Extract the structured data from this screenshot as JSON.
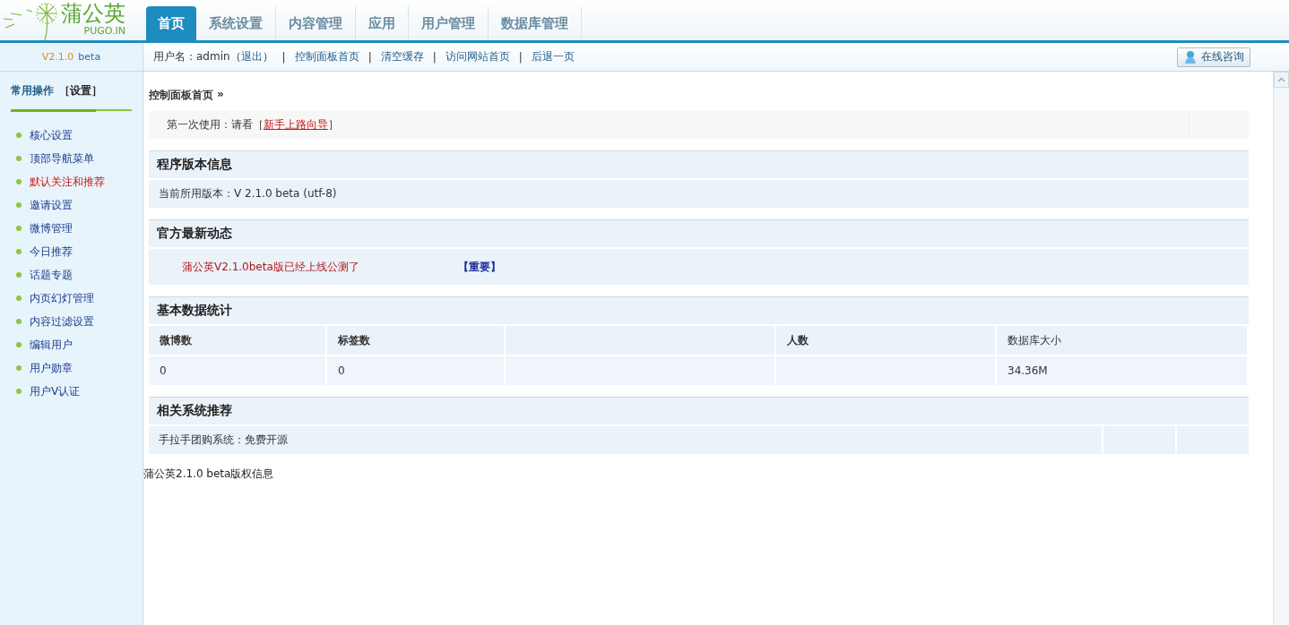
{
  "logo": {
    "title": "蒲公英",
    "subtitle": "PUGO.IN"
  },
  "tabs": [
    {
      "label": "首页",
      "selected": true
    },
    {
      "label": "系统设置",
      "selected": false
    },
    {
      "label": "内容管理",
      "selected": false
    },
    {
      "label": "应用",
      "selected": false
    },
    {
      "label": "用户管理",
      "selected": false
    },
    {
      "label": "数据库管理",
      "selected": false
    }
  ],
  "version": {
    "number": "V2.1.0",
    "edition": "beta"
  },
  "user_bar": {
    "user_text": "用户名：admin（",
    "logout": "退出",
    "user_text_end": "）",
    "links": [
      {
        "separator": "|",
        "label": "控制面板首页"
      },
      {
        "separator": "|",
        "label": "清空缓存"
      },
      {
        "separator": "|",
        "label": "访问网站首页"
      },
      {
        "separator": "|",
        "label": "后退一页"
      }
    ]
  },
  "consult_button": {
    "label": "在线咨询"
  },
  "sidebar": {
    "title": "常用操作",
    "setting_link": "［设置］",
    "items": [
      {
        "label": "核心设置",
        "selected": false
      },
      {
        "label": "顶部导航菜单",
        "selected": false
      },
      {
        "label": "默认关注和推荐",
        "selected": true
      },
      {
        "label": "邀请设置",
        "selected": false
      },
      {
        "label": "微博管理",
        "selected": false
      },
      {
        "label": "今日推荐",
        "selected": false
      },
      {
        "label": "话题专题",
        "selected": false
      },
      {
        "label": "内页幻灯管理",
        "selected": false
      },
      {
        "label": "内容过滤设置",
        "selected": false
      },
      {
        "label": "编辑用户",
        "selected": false
      },
      {
        "label": "用户勋章",
        "selected": false
      },
      {
        "label": "用户V认证",
        "selected": false
      }
    ]
  },
  "breadcrumb": {
    "label": "控制面板首页",
    "separator": "»"
  },
  "notice": {
    "prefix": "第一次使用：请看［",
    "link": "新手上路向导",
    "suffix": "］"
  },
  "sections": [
    {
      "kind": "info",
      "title": "程序版本信息",
      "text": "当前所用版本：V 2.1.0 beta (utf-8)"
    },
    {
      "kind": "news",
      "title": "官方最新动态",
      "items": [
        {
          "text": "蒲公英V2.1.0beta版已经上线公测了",
          "important": false
        },
        {
          "text": "【重要】",
          "important": true
        }
      ]
    },
    {
      "kind": "stats",
      "title": "基本数据统计",
      "columns": [
        {
          "header": "微博数",
          "value": "0"
        },
        {
          "header": "标签数",
          "value": "0"
        },
        {},
        {
          "header": "人数"
        },
        {
          "header": "数据库大小",
          "value": "34.36M"
        }
      ]
    },
    {
      "kind": "links",
      "title": "相关系统推荐",
      "text": "手拉手团购系统：免费开源"
    }
  ],
  "footer": "蒲公英2.1.0 beta版权信息"
}
